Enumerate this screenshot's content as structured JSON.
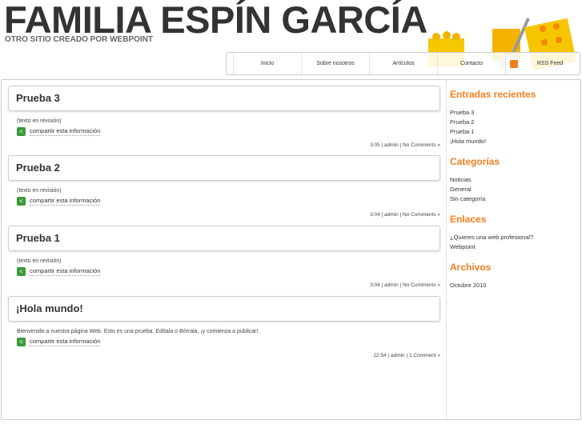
{
  "header": {
    "title": "FAMILIA ESPÍN GARCÍA",
    "tagline": "OTRO SITIO CREADO POR WEBPOINT"
  },
  "nav": {
    "items": [
      "Inicio",
      "Sobre nosotros",
      "Artículos",
      "Contacto"
    ],
    "rss": "RSS Feed"
  },
  "posts": [
    {
      "title": "Prueba 3",
      "body": "(texto en revisión)",
      "share": "compartir esta información",
      "meta": "3:05 | admin | No Comments »"
    },
    {
      "title": "Prueba 2",
      "body": "(texto en revisión)",
      "share": "compartir esta información",
      "meta": "3:04 | admin | No Comments »"
    },
    {
      "title": "Prueba 1",
      "body": "(texto en revisión)",
      "share": "compartir esta información",
      "meta": "3:04 | admin | No Comments »"
    },
    {
      "title": "¡Hola mundo!",
      "body": "Bienvenido a nuestra página Web. Esto es una prueba. Edítala o Bórrala, ¡y comienza a publicar!.",
      "share": "compartir esta información",
      "meta": "22:54 | admin | 1 Comment »"
    }
  ],
  "sidebar": {
    "recent": {
      "title": "Entradas recientes",
      "items": [
        "Prueba 3",
        "Prueba 2",
        "Prueba 1",
        "¡Hola mundo!"
      ]
    },
    "categories": {
      "title": "Categorías",
      "items": [
        "Noticias",
        "General",
        "Sin categoría"
      ]
    },
    "links": {
      "title": "Enlaces",
      "items": [
        "¿Quieres una web profesional?",
        "Webpoint"
      ]
    },
    "archives": {
      "title": "Archivos",
      "items": [
        "Octubre 2010"
      ]
    }
  },
  "colors": {
    "accent": "#f47f20",
    "share": "#3a9a3a",
    "rss": "#f07a1a"
  }
}
